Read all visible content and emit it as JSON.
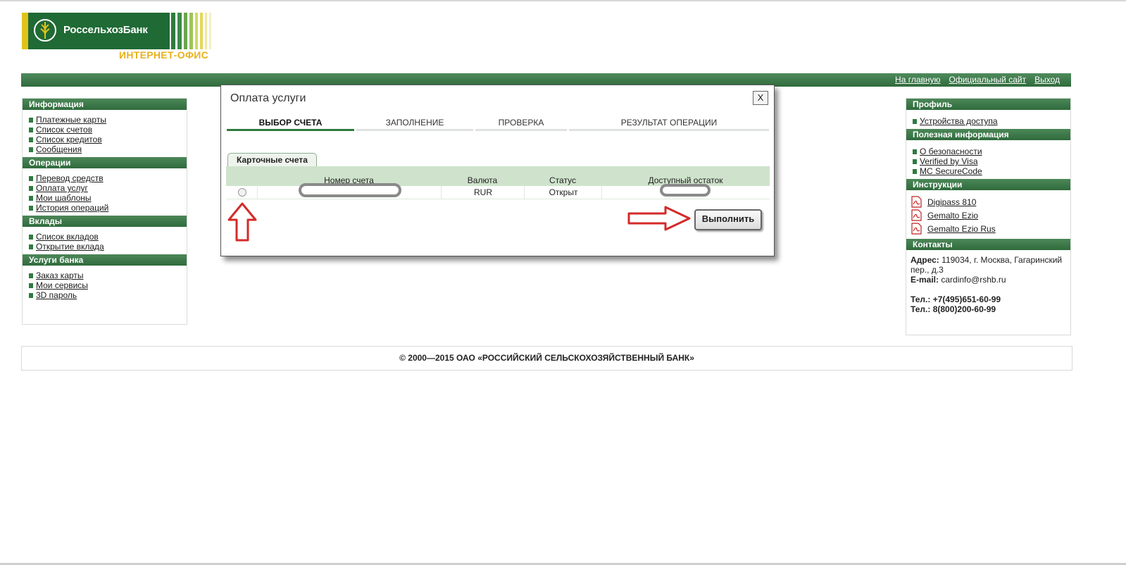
{
  "brand": {
    "name_prefix": "Россельхоз",
    "name_suffix": "Банк",
    "subtitle": "ИНТЕРНЕТ-ОФИС"
  },
  "topnav": [
    "На главную",
    "Официальный сайт",
    "Выход"
  ],
  "left_panels": [
    {
      "title": "Информация",
      "items": [
        "Платежные карты",
        "Список счетов",
        "Список кредитов",
        "Сообщения"
      ]
    },
    {
      "title": "Операции",
      "items": [
        "Перевод средств",
        "Оплата услуг",
        "Мои шаблоны",
        "История операций"
      ]
    },
    {
      "title": "Вклады",
      "items": [
        "Список вкладов",
        "Открытие вклада"
      ]
    },
    {
      "title": "Услуги банка",
      "items": [
        "Заказ карты",
        "Мои сервисы",
        "3D пароль"
      ]
    }
  ],
  "right_panels": {
    "profile": {
      "title": "Профиль",
      "items": [
        "Устройства доступа"
      ]
    },
    "useful": {
      "title": "Полезная информация",
      "items": [
        "О безопасности",
        "Verified by Visa",
        "MC SecureCode"
      ]
    },
    "instructions": {
      "title": "Инструкции",
      "items": [
        "Digipass 810",
        "Gemalto Ezio",
        "Gemalto Ezio Rus"
      ]
    },
    "contacts": {
      "title": "Контакты",
      "address_label": "Адрес:",
      "address_line1": "119034, г. Москва, Гагаринский",
      "address_line2": "пер., д.3",
      "email_label": "E-mail:",
      "email": "cardinfo@rshb.ru",
      "tel1_label": "Тел.:",
      "tel1": "+7(495)651-60-99",
      "tel2_label": "Тел.:",
      "tel2": "8(800)200-60-99"
    }
  },
  "footer": "© 2000—2015 ОАО «РОССИЙСКИЙ СЕЛЬСКОХОЗЯЙСТВЕННЫЙ БАНК»",
  "dialog": {
    "title": "Оплата услуги",
    "close": "X",
    "steps": [
      "ВЫБОР СЧЕТА",
      "ЗАПОЛНЕНИЕ",
      "ПРОВЕРКА",
      "РЕЗУЛЬТАТ ОПЕРАЦИИ"
    ],
    "active_step": 0,
    "tab": "Карточные счета",
    "columns": [
      "Номер счета",
      "Валюта",
      "Статус",
      "Доступный остаток"
    ],
    "row": {
      "currency": "RUR",
      "status": "Открыт"
    },
    "execute": "Выполнить"
  },
  "colors": {
    "brand_green": "#1f6a35",
    "accent_yellow": "#e8b11c",
    "annotation_red": "#d42a2a"
  }
}
